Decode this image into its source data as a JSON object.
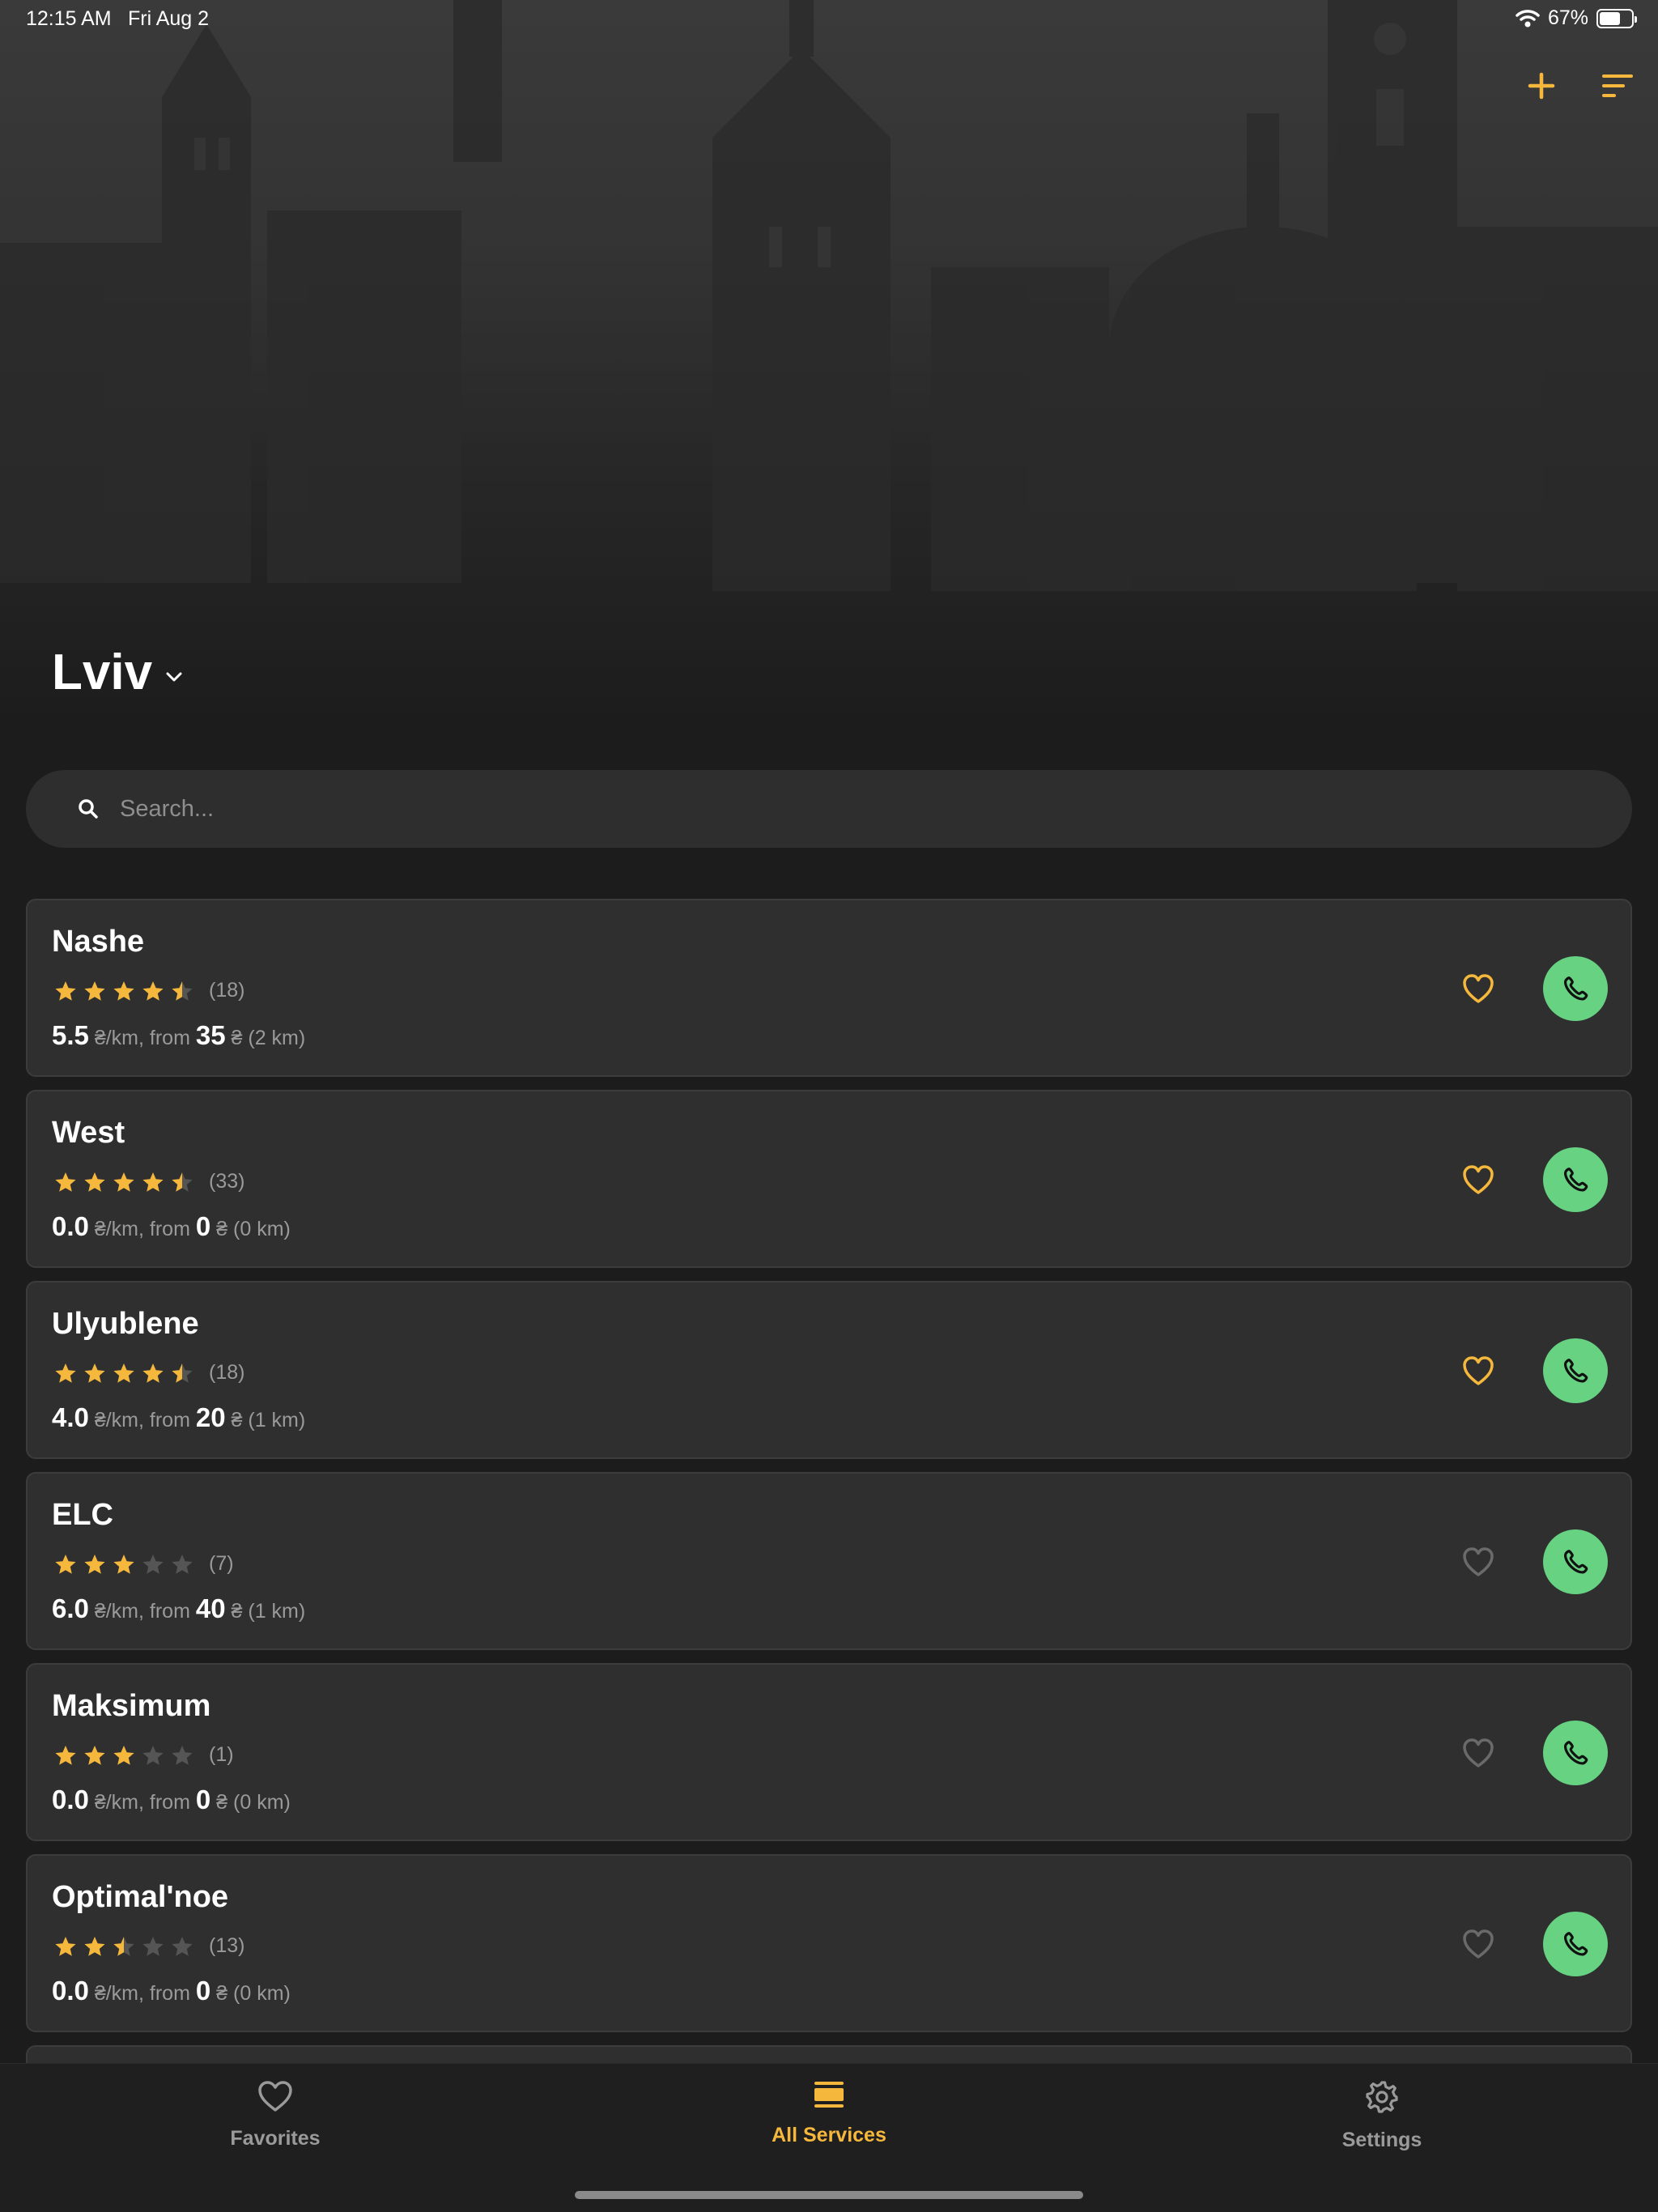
{
  "status": {
    "time": "12:15 AM",
    "date": "Fri Aug 2",
    "battery": "67%",
    "battery_level": 0.67
  },
  "header": {
    "add_icon": "plus-icon",
    "sort_icon": "sort-icon"
  },
  "city": {
    "name": "Lviv",
    "icon": "chevron-down-icon"
  },
  "search": {
    "placeholder": "Search...",
    "value": ""
  },
  "colors": {
    "accent": "#f5b83d",
    "call": "#67d281",
    "card": "#2f2f2f",
    "background": "#1c1c1c",
    "star_off": "#555555",
    "heart_off": "#6a6a6a"
  },
  "services": [
    {
      "name": "Nashe",
      "rating": 4.5,
      "reviews": "(18)",
      "price_km": "5.5",
      "km_unit": "₴/km, from",
      "min_price": "35",
      "min_suffix": "₴ (2 km)",
      "favorite": true
    },
    {
      "name": "West",
      "rating": 4.5,
      "reviews": "(33)",
      "price_km": "0.0",
      "km_unit": "₴/km, from",
      "min_price": "0",
      "min_suffix": "₴ (0 km)",
      "favorite": true
    },
    {
      "name": "Ulyublene",
      "rating": 4.5,
      "reviews": "(18)",
      "price_km": "4.0",
      "km_unit": "₴/km, from",
      "min_price": "20",
      "min_suffix": "₴ (1 km)",
      "favorite": true
    },
    {
      "name": "ELC",
      "rating": 3,
      "reviews": "(7)",
      "price_km": "6.0",
      "km_unit": "₴/km, from",
      "min_price": "40",
      "min_suffix": "₴ (1 km)",
      "favorite": false
    },
    {
      "name": "Maksimum",
      "rating": 3,
      "reviews": "(1)",
      "price_km": "0.0",
      "km_unit": "₴/km, from",
      "min_price": "0",
      "min_suffix": "₴ (0 km)",
      "favorite": false
    },
    {
      "name": "Optimal'noe",
      "rating": 2.5,
      "reviews": "(13)",
      "price_km": "0.0",
      "km_unit": "₴/km, from",
      "min_price": "0",
      "min_suffix": "₴ (0 km)",
      "favorite": false
    }
  ],
  "tabs": [
    {
      "label": "Favorites",
      "icon": "heart-icon",
      "active": false
    },
    {
      "label": "All Services",
      "icon": "list-icon",
      "active": true
    },
    {
      "label": "Settings",
      "icon": "gear-icon",
      "active": false
    }
  ]
}
